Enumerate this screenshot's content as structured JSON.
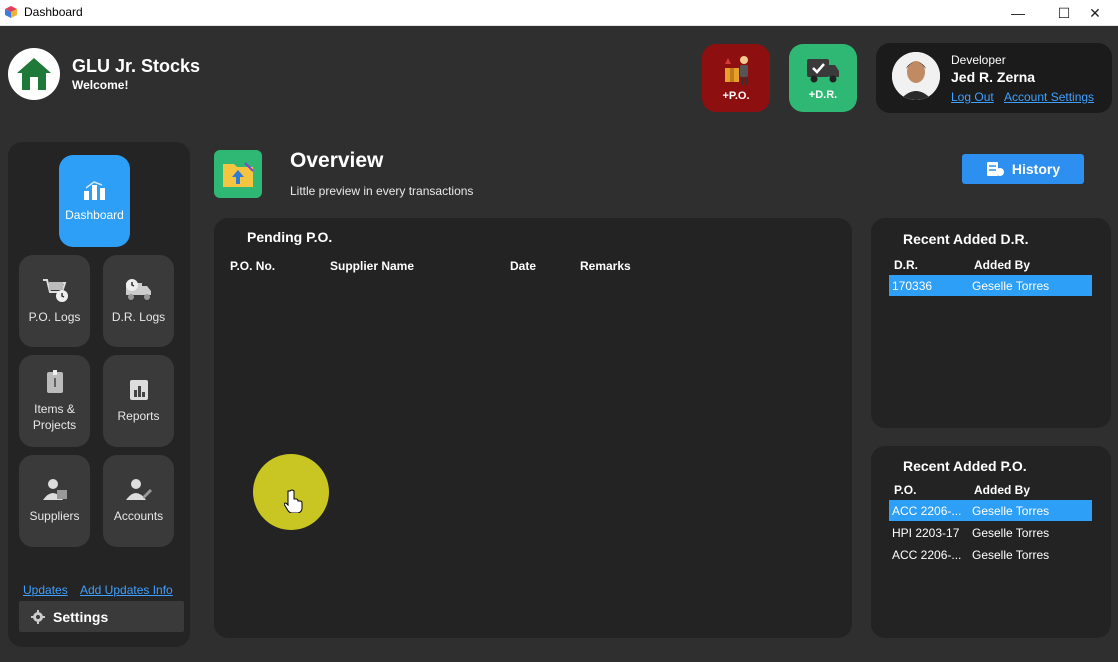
{
  "window": {
    "title": "Dashboard",
    "controls": [
      "—",
      "☐",
      "✕"
    ]
  },
  "header": {
    "app_name": "GLU Jr. Stocks",
    "welcome": "Welcome!"
  },
  "quick_actions": {
    "po_label": "+P.O.",
    "dr_label": "+D.R."
  },
  "user": {
    "role": "Developer",
    "name": "Jed R. Zerna",
    "logout": "Log Out",
    "account_settings": "Account Settings"
  },
  "sidebar": {
    "items": [
      {
        "label": "Dashboard",
        "icon": "dashboard-icon",
        "active": true
      },
      {
        "label": "P.O. Logs",
        "icon": "cart-clock-icon"
      },
      {
        "label": "D.R. Logs",
        "icon": "truck-clock-icon"
      },
      {
        "label": "Items &",
        "label2": "Projects",
        "icon": "items-icon"
      },
      {
        "label": "Reports",
        "icon": "report-icon"
      },
      {
        "label": "Suppliers",
        "icon": "supplier-icon"
      },
      {
        "label": "Accounts",
        "icon": "accounts-icon"
      }
    ],
    "updates": "Updates",
    "add_updates": "Add Updates Info",
    "settings": "Settings"
  },
  "overview": {
    "title": "Overview",
    "subtitle": "Little preview in every transactions",
    "history": "History"
  },
  "pending_po": {
    "title": "Pending P.O.",
    "columns": [
      "P.O. No.",
      "Supplier Name",
      "Date",
      "Remarks"
    ],
    "rows": []
  },
  "recent_dr": {
    "title": "Recent Added D.R.",
    "columns": [
      "D.R.",
      "Added By"
    ],
    "rows": [
      {
        "no": "170336",
        "by": "Geselle Torres",
        "selected": true
      }
    ]
  },
  "recent_po": {
    "title": "Recent Added P.O.",
    "columns": [
      "P.O.",
      "Added By"
    ],
    "rows": [
      {
        "no": "ACC 2206-...",
        "by": "Geselle Torres",
        "selected": true
      },
      {
        "no": "HPI 2203-17",
        "by": "Geselle Torres"
      },
      {
        "no": "ACC 2206-...",
        "by": "Geselle Torres"
      }
    ]
  },
  "colors": {
    "accent": "#2d9ff7",
    "po_button": "#8d0f0f",
    "dr_button": "#2fb873",
    "background": "#2f2f2f",
    "panel": "#232323"
  }
}
